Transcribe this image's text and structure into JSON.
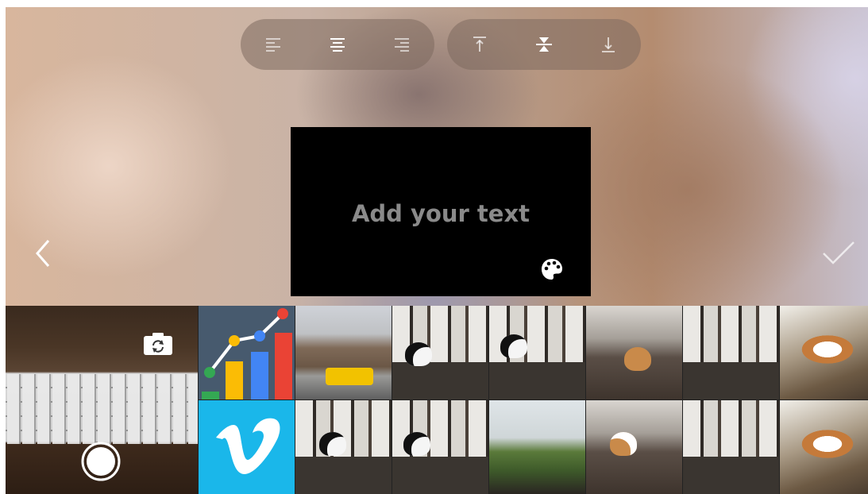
{
  "toolbar": {
    "horizontal": [
      {
        "icon": "align-left-icon",
        "selected": false
      },
      {
        "icon": "align-center-icon",
        "selected": true
      },
      {
        "icon": "align-right-icon",
        "selected": false
      }
    ],
    "vertical": [
      {
        "icon": "align-top-icon",
        "selected": false
      },
      {
        "icon": "align-middle-icon",
        "selected": true
      },
      {
        "icon": "align-bottom-icon",
        "selected": false
      }
    ]
  },
  "text_card": {
    "placeholder": "Add your text",
    "background": "#000000",
    "text_color": "#8a8a8a"
  },
  "nav": {
    "back_icon": "chevron-left-icon",
    "confirm_icon": "checkmark-icon"
  },
  "gallery": {
    "camera_tile": {
      "flip_icon": "camera-flip-icon",
      "shutter_icon": "shutter-icon"
    },
    "tiles": [
      {
        "kind": "chart-app-icon"
      },
      {
        "kind": "photo-street-van"
      },
      {
        "kind": "photo-window-cat"
      },
      {
        "kind": "photo-window-cat"
      },
      {
        "kind": "photo-dogs-sofa"
      },
      {
        "kind": "photo-window-sofa"
      },
      {
        "kind": "photo-dogs-floor"
      },
      {
        "kind": "vimeo-app-icon"
      },
      {
        "kind": "photo-window-cat"
      },
      {
        "kind": "photo-window-cat"
      },
      {
        "kind": "photo-window-plant"
      },
      {
        "kind": "photo-dogs-sofa"
      },
      {
        "kind": "photo-window-sofa"
      },
      {
        "kind": "photo-dogs-floor"
      }
    ]
  },
  "colors": {
    "toolbar_bg": "rgba(125,105,95,0.55)",
    "icon_active": "#ffffff",
    "icon_inactive": "rgba(255,255,255,0.6)",
    "vimeo_blue": "#1ab7ea"
  }
}
